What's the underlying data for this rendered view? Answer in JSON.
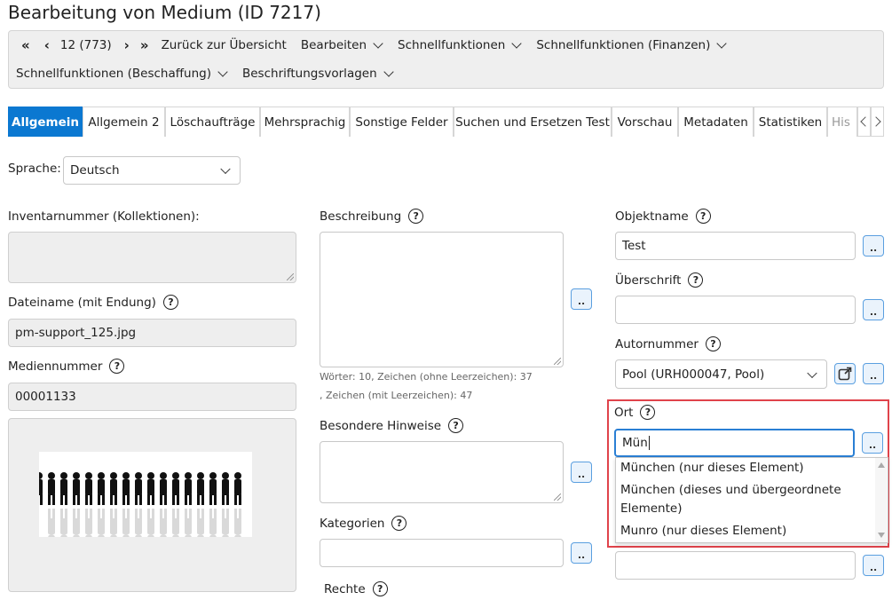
{
  "page": {
    "title": "Bearbeitung von Medium (ID 7217)"
  },
  "toolbar": {
    "first_icon": "«",
    "prev_icon": "‹",
    "record_position": "12 (773)",
    "next_icon": "›",
    "last_icon": "»",
    "back_label": "Zurück zur Übersicht",
    "edit_label": "Bearbeiten",
    "quick_label": "Schnellfunktionen",
    "quick_finance_label": "Schnellfunktionen (Finanzen)",
    "quick_procurement_label": "Schnellfunktionen (Beschaffung)",
    "label_templates_label": "Beschriftungsvorlagen"
  },
  "tabs": [
    {
      "label": "Allgemein",
      "active": true
    },
    {
      "label": "Allgemein 2"
    },
    {
      "label": "Löschaufträge"
    },
    {
      "label": "Mehrsprachig"
    },
    {
      "label": "Sonstige Felder"
    },
    {
      "label": "Suchen und Ersetzen Test"
    },
    {
      "label": "Vorschau"
    },
    {
      "label": "Metadaten"
    },
    {
      "label": "Statistiken"
    },
    {
      "label": "His"
    }
  ],
  "language": {
    "label": "Sprache:",
    "value": "Deutsch"
  },
  "left": {
    "inventory_label": "Inventarnummer (Kollektionen):",
    "inventory_value": "",
    "filename_label": "Dateiname (mit Endung)",
    "filename_value": "pm-support_125.jpg",
    "media_number_label": "Mediennummer",
    "media_number_value": "00001133"
  },
  "middle": {
    "description_label": "Beschreibung",
    "description_value": "",
    "stats_line1": "Wörter: 10, Zeichen (ohne Leerzeichen): 37",
    "stats_line2": ", Zeichen (mit Leerzeichen): 47",
    "notes_label": "Besondere Hinweise",
    "categories_label": "Kategorien",
    "rights_label": "Rechte"
  },
  "right": {
    "object_name_label": "Objektname",
    "object_name_value": "Test",
    "heading_label": "Überschrift",
    "heading_value": "",
    "author_number_label": "Autornummer",
    "author_number_value": "Pool (URH000047, Pool)",
    "place_label": "Ort",
    "place_value": "Mün",
    "place_suggestions": [
      "München   (nur dieses Element)",
      "München   (dieses und übergeordnete",
      "Elemente)",
      "Munro   (nur dieses Element)"
    ]
  },
  "buttons": {
    "more_label": ".."
  },
  "colors": {
    "accent": "#0b78d1",
    "highlight": "#e0434b",
    "toolbar_bg": "#efefef",
    "readonly_bg": "#eeeeee"
  }
}
